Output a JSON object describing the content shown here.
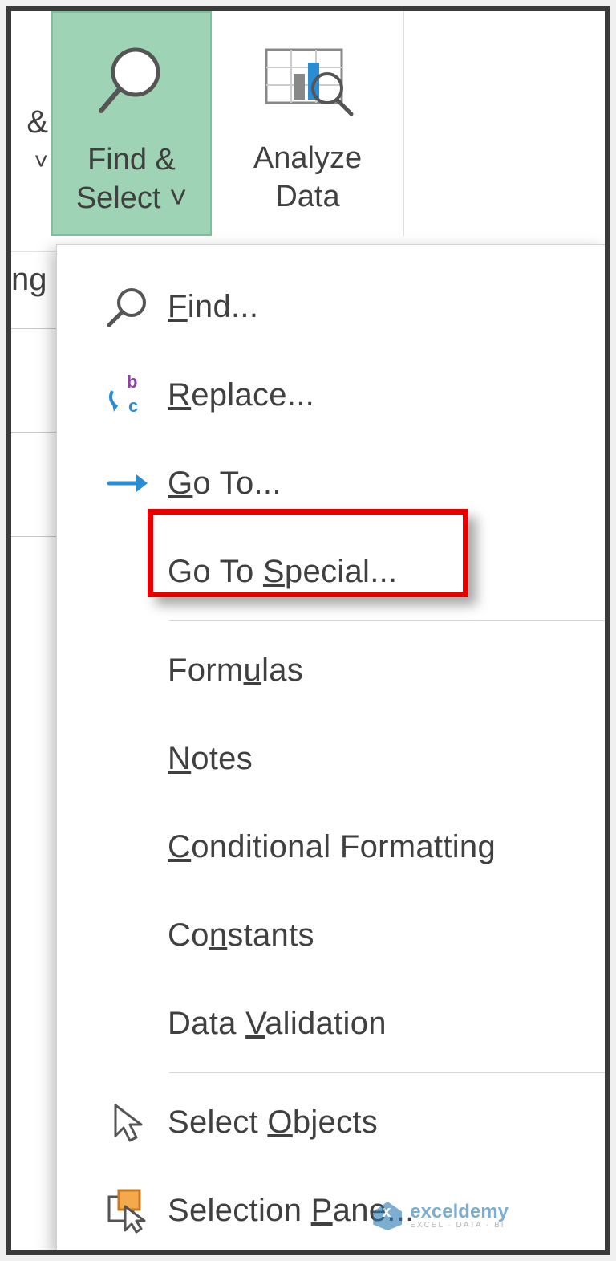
{
  "ribbon": {
    "partial_left": {
      "amp": "&",
      "chev": "˅"
    },
    "find_select": {
      "line1": "Find &",
      "line2": "Select ˅"
    },
    "analyze_data": {
      "line1": "Analyze",
      "line2": "Data"
    },
    "trailing_group": "ng"
  },
  "menu": {
    "find": {
      "pre": "",
      "u": "F",
      "post": "ind..."
    },
    "replace": {
      "pre": "",
      "u": "R",
      "post": "eplace..."
    },
    "goto": {
      "pre": "",
      "u": "G",
      "post": "o To..."
    },
    "gotospecial": {
      "pre": "Go To ",
      "u": "S",
      "post": "pecial..."
    },
    "formulas": {
      "pre": "Form",
      "u": "u",
      "post": "las"
    },
    "notes": {
      "pre": "",
      "u": "N",
      "post": "otes"
    },
    "condformat": {
      "pre": "",
      "u": "C",
      "post": "onditional Formatting"
    },
    "constants": {
      "pre": "Co",
      "u": "n",
      "post": "stants"
    },
    "datavalidation": {
      "pre": "Data ",
      "u": "V",
      "post": "alidation"
    },
    "selectobjects": {
      "pre": "Select ",
      "u": "O",
      "post": "bjects"
    },
    "selectionpane": {
      "pre": "Selection ",
      "u": "P",
      "post": "ane..."
    }
  },
  "watermark": {
    "main": "exceldemy",
    "sub": "EXCEL · DATA · BI"
  }
}
